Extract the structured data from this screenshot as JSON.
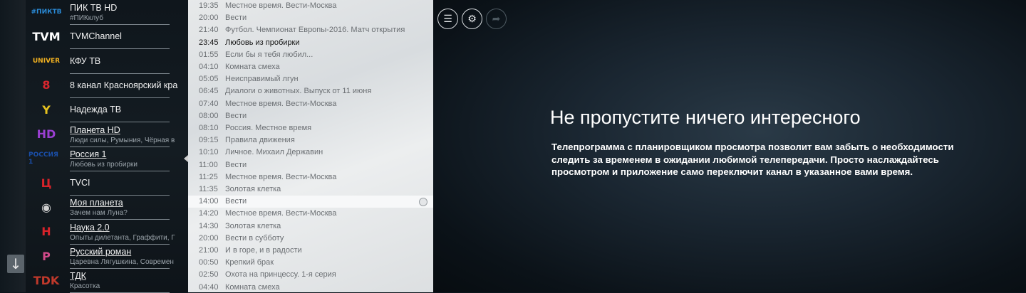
{
  "channels": [
    {
      "name": "ПИК ТВ HD",
      "sub": "#ПИКклуб",
      "logo": "#ПИКТВ",
      "logo_color": "#2a8ad6",
      "underline": false
    },
    {
      "name": "TVMChannel",
      "sub": "",
      "logo": "TVM",
      "logo_color": "#ffffff",
      "underline": false
    },
    {
      "name": "КФУ ТВ",
      "sub": "",
      "logo": "UNIVER",
      "logo_color": "#f0b020",
      "underline": false
    },
    {
      "name": "8 канал Красноярский кра",
      "sub": "",
      "logo": "8",
      "logo_color": "#d7262e",
      "underline": false
    },
    {
      "name": "Надежда ТВ",
      "sub": "",
      "logo": "Y",
      "logo_color": "#e6c21f",
      "underline": false
    },
    {
      "name": "Планета HD",
      "sub": "Люди силы, Румыния, Чёрная в",
      "logo": "HD",
      "logo_color": "#9a3fd1",
      "underline": true
    },
    {
      "name": "Россия 1",
      "sub": "Любовь из пробирки",
      "logo": "РОССИЯ 1",
      "logo_color": "#1a4ea8",
      "underline": true
    },
    {
      "name": "TVCI",
      "sub": "",
      "logo": "Ц",
      "logo_color": "#d8232a",
      "underline": false
    },
    {
      "name": "Моя планета",
      "sub": "Зачем нам Луна?",
      "logo": "◉",
      "logo_color": "#cfcfcf",
      "underline": true
    },
    {
      "name": "Наука 2.0",
      "sub": "Опыты дилетанта, Граффити, Г",
      "logo": "Н",
      "logo_color": "#d8232a",
      "underline": true
    },
    {
      "name": "Русский роман",
      "sub": "Царевна Лягушкина, Современ",
      "logo": "P",
      "logo_color": "#d24a8a",
      "underline": true
    },
    {
      "name": "ТДК",
      "sub": "Красотка",
      "logo": "TDK",
      "logo_color": "#c0392b",
      "underline": true
    }
  ],
  "epg": [
    {
      "time": "19:35",
      "title": "Местное время. Вести-Москва"
    },
    {
      "time": "20:00",
      "title": "Вести"
    },
    {
      "time": "21:40",
      "title": "Футбол. Чемпионат Европы-2016. Матч открытия"
    },
    {
      "time": "23:45",
      "title": "Любовь из пробирки"
    },
    {
      "time": "01:55",
      "title": "Если бы я тебя любил..."
    },
    {
      "time": "04:10",
      "title": "Комната смеха"
    },
    {
      "time": "05:05",
      "title": "Неисправимый лгун"
    },
    {
      "time": "06:45",
      "title": "Диалоги о животных. Выпуск от 11 июня"
    },
    {
      "time": "07:40",
      "title": "Местное время. Вести-Москва"
    },
    {
      "time": "08:00",
      "title": "Вести"
    },
    {
      "time": "08:10",
      "title": "Россия. Местное время"
    },
    {
      "time": "09:15",
      "title": "Правила движения"
    },
    {
      "time": "10:10",
      "title": "Личное. Михаил Державин"
    },
    {
      "time": "11:00",
      "title": "Вести"
    },
    {
      "time": "11:25",
      "title": "Местное время. Вести-Москва"
    },
    {
      "time": "11:35",
      "title": "Золотая клетка"
    },
    {
      "time": "14:00",
      "title": "Вести"
    },
    {
      "time": "14:20",
      "title": "Местное время. Вести-Москва"
    },
    {
      "time": "14:30",
      "title": "Золотая клетка"
    },
    {
      "time": "20:00",
      "title": "Вести в субботу"
    },
    {
      "time": "21:00",
      "title": "И в горе, и в радости"
    },
    {
      "time": "00:50",
      "title": "Крепкий брак"
    },
    {
      "time": "02:50",
      "title": "Охота на принцессу. 1-я серия"
    },
    {
      "time": "04:40",
      "title": "Комната смеха"
    }
  ],
  "epg_current_index": 3,
  "epg_highlight_index": 16,
  "toolbar": {
    "icons": [
      "list-icon",
      "gear-icon",
      "share-icon"
    ],
    "list_glyph": "☰",
    "gear_glyph": "⚙",
    "share_glyph": "➦"
  },
  "nav": {
    "down_glyph": "↓"
  },
  "promo": {
    "title": "Не пропустите ничего интересного",
    "text": "Телепрограмма с планировщиком просмотра позволит вам забыть о необходимости следить за временем в ожидании любимой телепередачи. Просто наслаждайтесь просмотром и приложение само переключит канал в указанное вами время."
  }
}
